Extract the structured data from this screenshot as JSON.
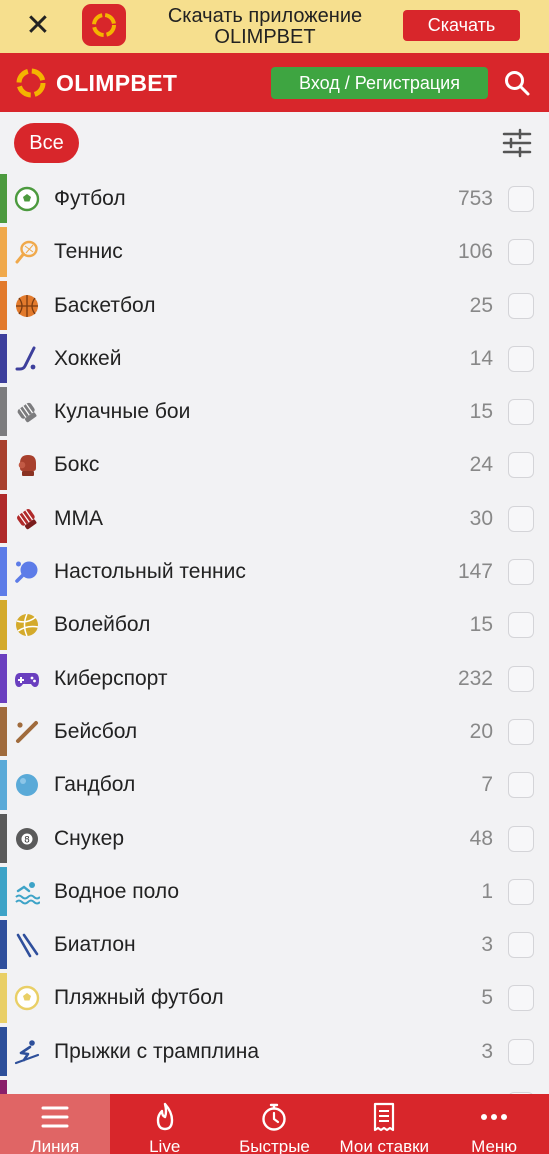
{
  "promo": {
    "title_line1": "Скачать приложение",
    "title_line2": "OLIMPBET",
    "download_label": "Скачать",
    "close_glyph": "✕"
  },
  "header": {
    "brand": "OLIMPBET",
    "login_label": "Вход / Регистрация"
  },
  "filter": {
    "all_label": "Все"
  },
  "sports": [
    {
      "name": "Футбол",
      "count": "753",
      "icon": "soccer-ball-icon",
      "color": "#4c9a3e"
    },
    {
      "name": "Теннис",
      "count": "106",
      "icon": "tennis-racket-icon",
      "color": "#f0a94b"
    },
    {
      "name": "Баскетбол",
      "count": "25",
      "icon": "basketball-icon",
      "color": "#e27a2c"
    },
    {
      "name": "Хоккей",
      "count": "14",
      "icon": "hockey-stick-icon",
      "color": "#3d3f9c"
    },
    {
      "name": "Кулачные бои",
      "count": "15",
      "icon": "fist-icon",
      "color": "#7c7c7e"
    },
    {
      "name": "Бокс",
      "count": "24",
      "icon": "boxing-glove-icon",
      "color": "#a8402d"
    },
    {
      "name": "ММА",
      "count": "30",
      "icon": "mma-glove-icon",
      "color": "#b02a2a"
    },
    {
      "name": "Настольный теннис",
      "count": "147",
      "icon": "table-tennis-icon",
      "color": "#5d7ce8"
    },
    {
      "name": "Волейбол",
      "count": "15",
      "icon": "volleyball-icon",
      "color": "#d4aa2b"
    },
    {
      "name": "Киберспорт",
      "count": "232",
      "icon": "gamepad-icon",
      "color": "#6a3fbf"
    },
    {
      "name": "Бейсбол",
      "count": "20",
      "icon": "baseball-bat-icon",
      "color": "#a06b3c"
    },
    {
      "name": "Гандбол",
      "count": "7",
      "icon": "handball-icon",
      "color": "#5aaad8"
    },
    {
      "name": "Снукер",
      "count": "48",
      "icon": "snooker-ball-icon",
      "color": "#5a5a5a"
    },
    {
      "name": "Водное поло",
      "count": "1",
      "icon": "water-polo-icon",
      "color": "#3da3c7"
    },
    {
      "name": "Биатлон",
      "count": "3",
      "icon": "biathlon-skis-icon",
      "color": "#2f4f9c"
    },
    {
      "name": "Пляжный футбол",
      "count": "5",
      "icon": "beach-soccer-icon",
      "color": "#e9cf66"
    },
    {
      "name": "Прыжки с трамплина",
      "count": "3",
      "icon": "ski-jump-icon",
      "color": "#2d4f9a"
    },
    {
      "name": "",
      "count": "",
      "icon": "",
      "color": "#8a1f6a"
    }
  ],
  "bottom_nav": [
    {
      "label": "Линия",
      "icon": "list-icon",
      "active": true
    },
    {
      "label": "Live",
      "icon": "flame-icon",
      "active": false
    },
    {
      "label": "Быстрые",
      "icon": "stopwatch-icon",
      "active": false
    },
    {
      "label": "Мои ставки",
      "icon": "receipt-icon",
      "active": false
    },
    {
      "label": "Меню",
      "icon": "more-dots-icon",
      "active": false
    }
  ],
  "colors": {
    "brand_red": "#d8262b",
    "login_green": "#3ea541",
    "promo_yellow": "#f6df8e"
  }
}
